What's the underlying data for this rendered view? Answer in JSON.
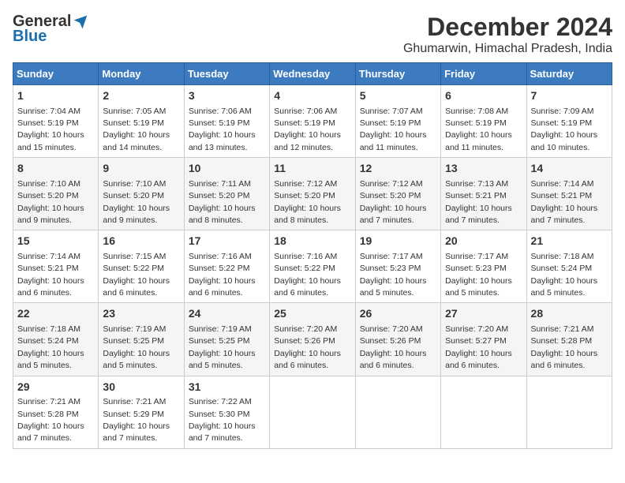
{
  "header": {
    "logo_line1": "General",
    "logo_line2": "Blue",
    "month": "December 2024",
    "location": "Ghumarwin, Himachal Pradesh, India"
  },
  "weekdays": [
    "Sunday",
    "Monday",
    "Tuesday",
    "Wednesday",
    "Thursday",
    "Friday",
    "Saturday"
  ],
  "weeks": [
    [
      {
        "day": 1,
        "sunrise": "7:04 AM",
        "sunset": "5:19 PM",
        "daylight": "10 hours and 15 minutes."
      },
      {
        "day": 2,
        "sunrise": "7:05 AM",
        "sunset": "5:19 PM",
        "daylight": "10 hours and 14 minutes."
      },
      {
        "day": 3,
        "sunrise": "7:06 AM",
        "sunset": "5:19 PM",
        "daylight": "10 hours and 13 minutes."
      },
      {
        "day": 4,
        "sunrise": "7:06 AM",
        "sunset": "5:19 PM",
        "daylight": "10 hours and 12 minutes."
      },
      {
        "day": 5,
        "sunrise": "7:07 AM",
        "sunset": "5:19 PM",
        "daylight": "10 hours and 11 minutes."
      },
      {
        "day": 6,
        "sunrise": "7:08 AM",
        "sunset": "5:19 PM",
        "daylight": "10 hours and 11 minutes."
      },
      {
        "day": 7,
        "sunrise": "7:09 AM",
        "sunset": "5:19 PM",
        "daylight": "10 hours and 10 minutes."
      }
    ],
    [
      {
        "day": 8,
        "sunrise": "7:10 AM",
        "sunset": "5:20 PM",
        "daylight": "10 hours and 9 minutes."
      },
      {
        "day": 9,
        "sunrise": "7:10 AM",
        "sunset": "5:20 PM",
        "daylight": "10 hours and 9 minutes."
      },
      {
        "day": 10,
        "sunrise": "7:11 AM",
        "sunset": "5:20 PM",
        "daylight": "10 hours and 8 minutes."
      },
      {
        "day": 11,
        "sunrise": "7:12 AM",
        "sunset": "5:20 PM",
        "daylight": "10 hours and 8 minutes."
      },
      {
        "day": 12,
        "sunrise": "7:12 AM",
        "sunset": "5:20 PM",
        "daylight": "10 hours and 7 minutes."
      },
      {
        "day": 13,
        "sunrise": "7:13 AM",
        "sunset": "5:21 PM",
        "daylight": "10 hours and 7 minutes."
      },
      {
        "day": 14,
        "sunrise": "7:14 AM",
        "sunset": "5:21 PM",
        "daylight": "10 hours and 7 minutes."
      }
    ],
    [
      {
        "day": 15,
        "sunrise": "7:14 AM",
        "sunset": "5:21 PM",
        "daylight": "10 hours and 6 minutes."
      },
      {
        "day": 16,
        "sunrise": "7:15 AM",
        "sunset": "5:22 PM",
        "daylight": "10 hours and 6 minutes."
      },
      {
        "day": 17,
        "sunrise": "7:16 AM",
        "sunset": "5:22 PM",
        "daylight": "10 hours and 6 minutes."
      },
      {
        "day": 18,
        "sunrise": "7:16 AM",
        "sunset": "5:22 PM",
        "daylight": "10 hours and 6 minutes."
      },
      {
        "day": 19,
        "sunrise": "7:17 AM",
        "sunset": "5:23 PM",
        "daylight": "10 hours and 5 minutes."
      },
      {
        "day": 20,
        "sunrise": "7:17 AM",
        "sunset": "5:23 PM",
        "daylight": "10 hours and 5 minutes."
      },
      {
        "day": 21,
        "sunrise": "7:18 AM",
        "sunset": "5:24 PM",
        "daylight": "10 hours and 5 minutes."
      }
    ],
    [
      {
        "day": 22,
        "sunrise": "7:18 AM",
        "sunset": "5:24 PM",
        "daylight": "10 hours and 5 minutes."
      },
      {
        "day": 23,
        "sunrise": "7:19 AM",
        "sunset": "5:25 PM",
        "daylight": "10 hours and 5 minutes."
      },
      {
        "day": 24,
        "sunrise": "7:19 AM",
        "sunset": "5:25 PM",
        "daylight": "10 hours and 5 minutes."
      },
      {
        "day": 25,
        "sunrise": "7:20 AM",
        "sunset": "5:26 PM",
        "daylight": "10 hours and 6 minutes."
      },
      {
        "day": 26,
        "sunrise": "7:20 AM",
        "sunset": "5:26 PM",
        "daylight": "10 hours and 6 minutes."
      },
      {
        "day": 27,
        "sunrise": "7:20 AM",
        "sunset": "5:27 PM",
        "daylight": "10 hours and 6 minutes."
      },
      {
        "day": 28,
        "sunrise": "7:21 AM",
        "sunset": "5:28 PM",
        "daylight": "10 hours and 6 minutes."
      }
    ],
    [
      {
        "day": 29,
        "sunrise": "7:21 AM",
        "sunset": "5:28 PM",
        "daylight": "10 hours and 7 minutes."
      },
      {
        "day": 30,
        "sunrise": "7:21 AM",
        "sunset": "5:29 PM",
        "daylight": "10 hours and 7 minutes."
      },
      {
        "day": 31,
        "sunrise": "7:22 AM",
        "sunset": "5:30 PM",
        "daylight": "10 hours and 7 minutes."
      },
      null,
      null,
      null,
      null
    ]
  ]
}
